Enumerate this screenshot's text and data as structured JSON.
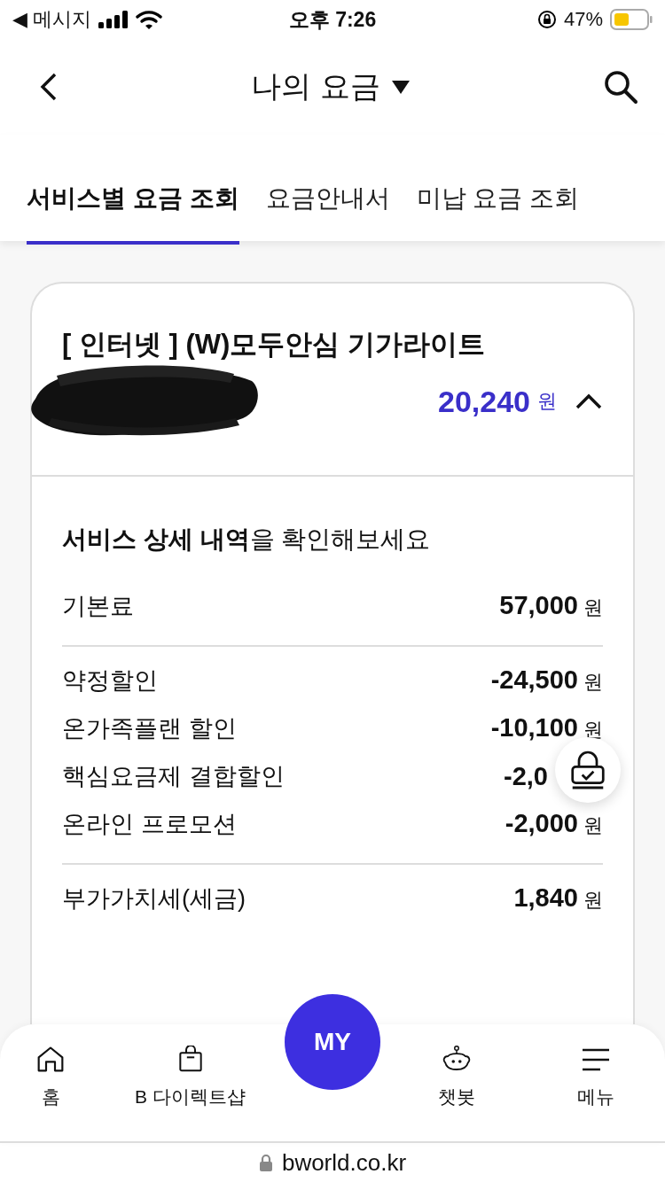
{
  "status_bar": {
    "back_app": "◀ 메시지",
    "time": "오후 7:26",
    "battery": "47%"
  },
  "header": {
    "title": "나의 요금"
  },
  "tabs": [
    {
      "label": "서비스별 요금 조회",
      "selected": true
    },
    {
      "label": "요금안내서",
      "selected": false
    },
    {
      "label": "미납 요금 조회",
      "selected": false
    }
  ],
  "bill_card": {
    "title": "[ 인터넷 ] (W)모두안심 기가라이트",
    "amount": "20,240",
    "unit": "원",
    "expanded": true,
    "detail_heading": "**서비스 상세 내역**을 확인해보세요",
    "groups": [
      [
        {
          "label": "기본료",
          "amount": "57,000",
          "unit": "원"
        }
      ],
      [
        {
          "label": "약정할인",
          "amount": "-24,500",
          "unit": "원"
        },
        {
          "label": "온가족플랜 할인",
          "amount": "-10,100",
          "unit": "원"
        },
        {
          "label": "핵심요금제 결합할인",
          "amount": "-2,0"
        },
        {
          "label": "온라인 프로모션",
          "amount": "-2,000",
          "unit": "원"
        }
      ],
      [
        {
          "label": "부가가치세(세금)",
          "amount": "1,840",
          "unit": "원"
        }
      ]
    ]
  },
  "bottom_nav": {
    "items": [
      {
        "label": "홈",
        "kind": "home"
      },
      {
        "label": "B 다이렉트샵",
        "kind": "shop"
      },
      {
        "label": "챗봇",
        "kind": "bot"
      },
      {
        "label": "메뉴",
        "kind": "menu"
      }
    ],
    "center_button": "MY"
  },
  "url_bar": {
    "url": "bworld.co.kr"
  }
}
